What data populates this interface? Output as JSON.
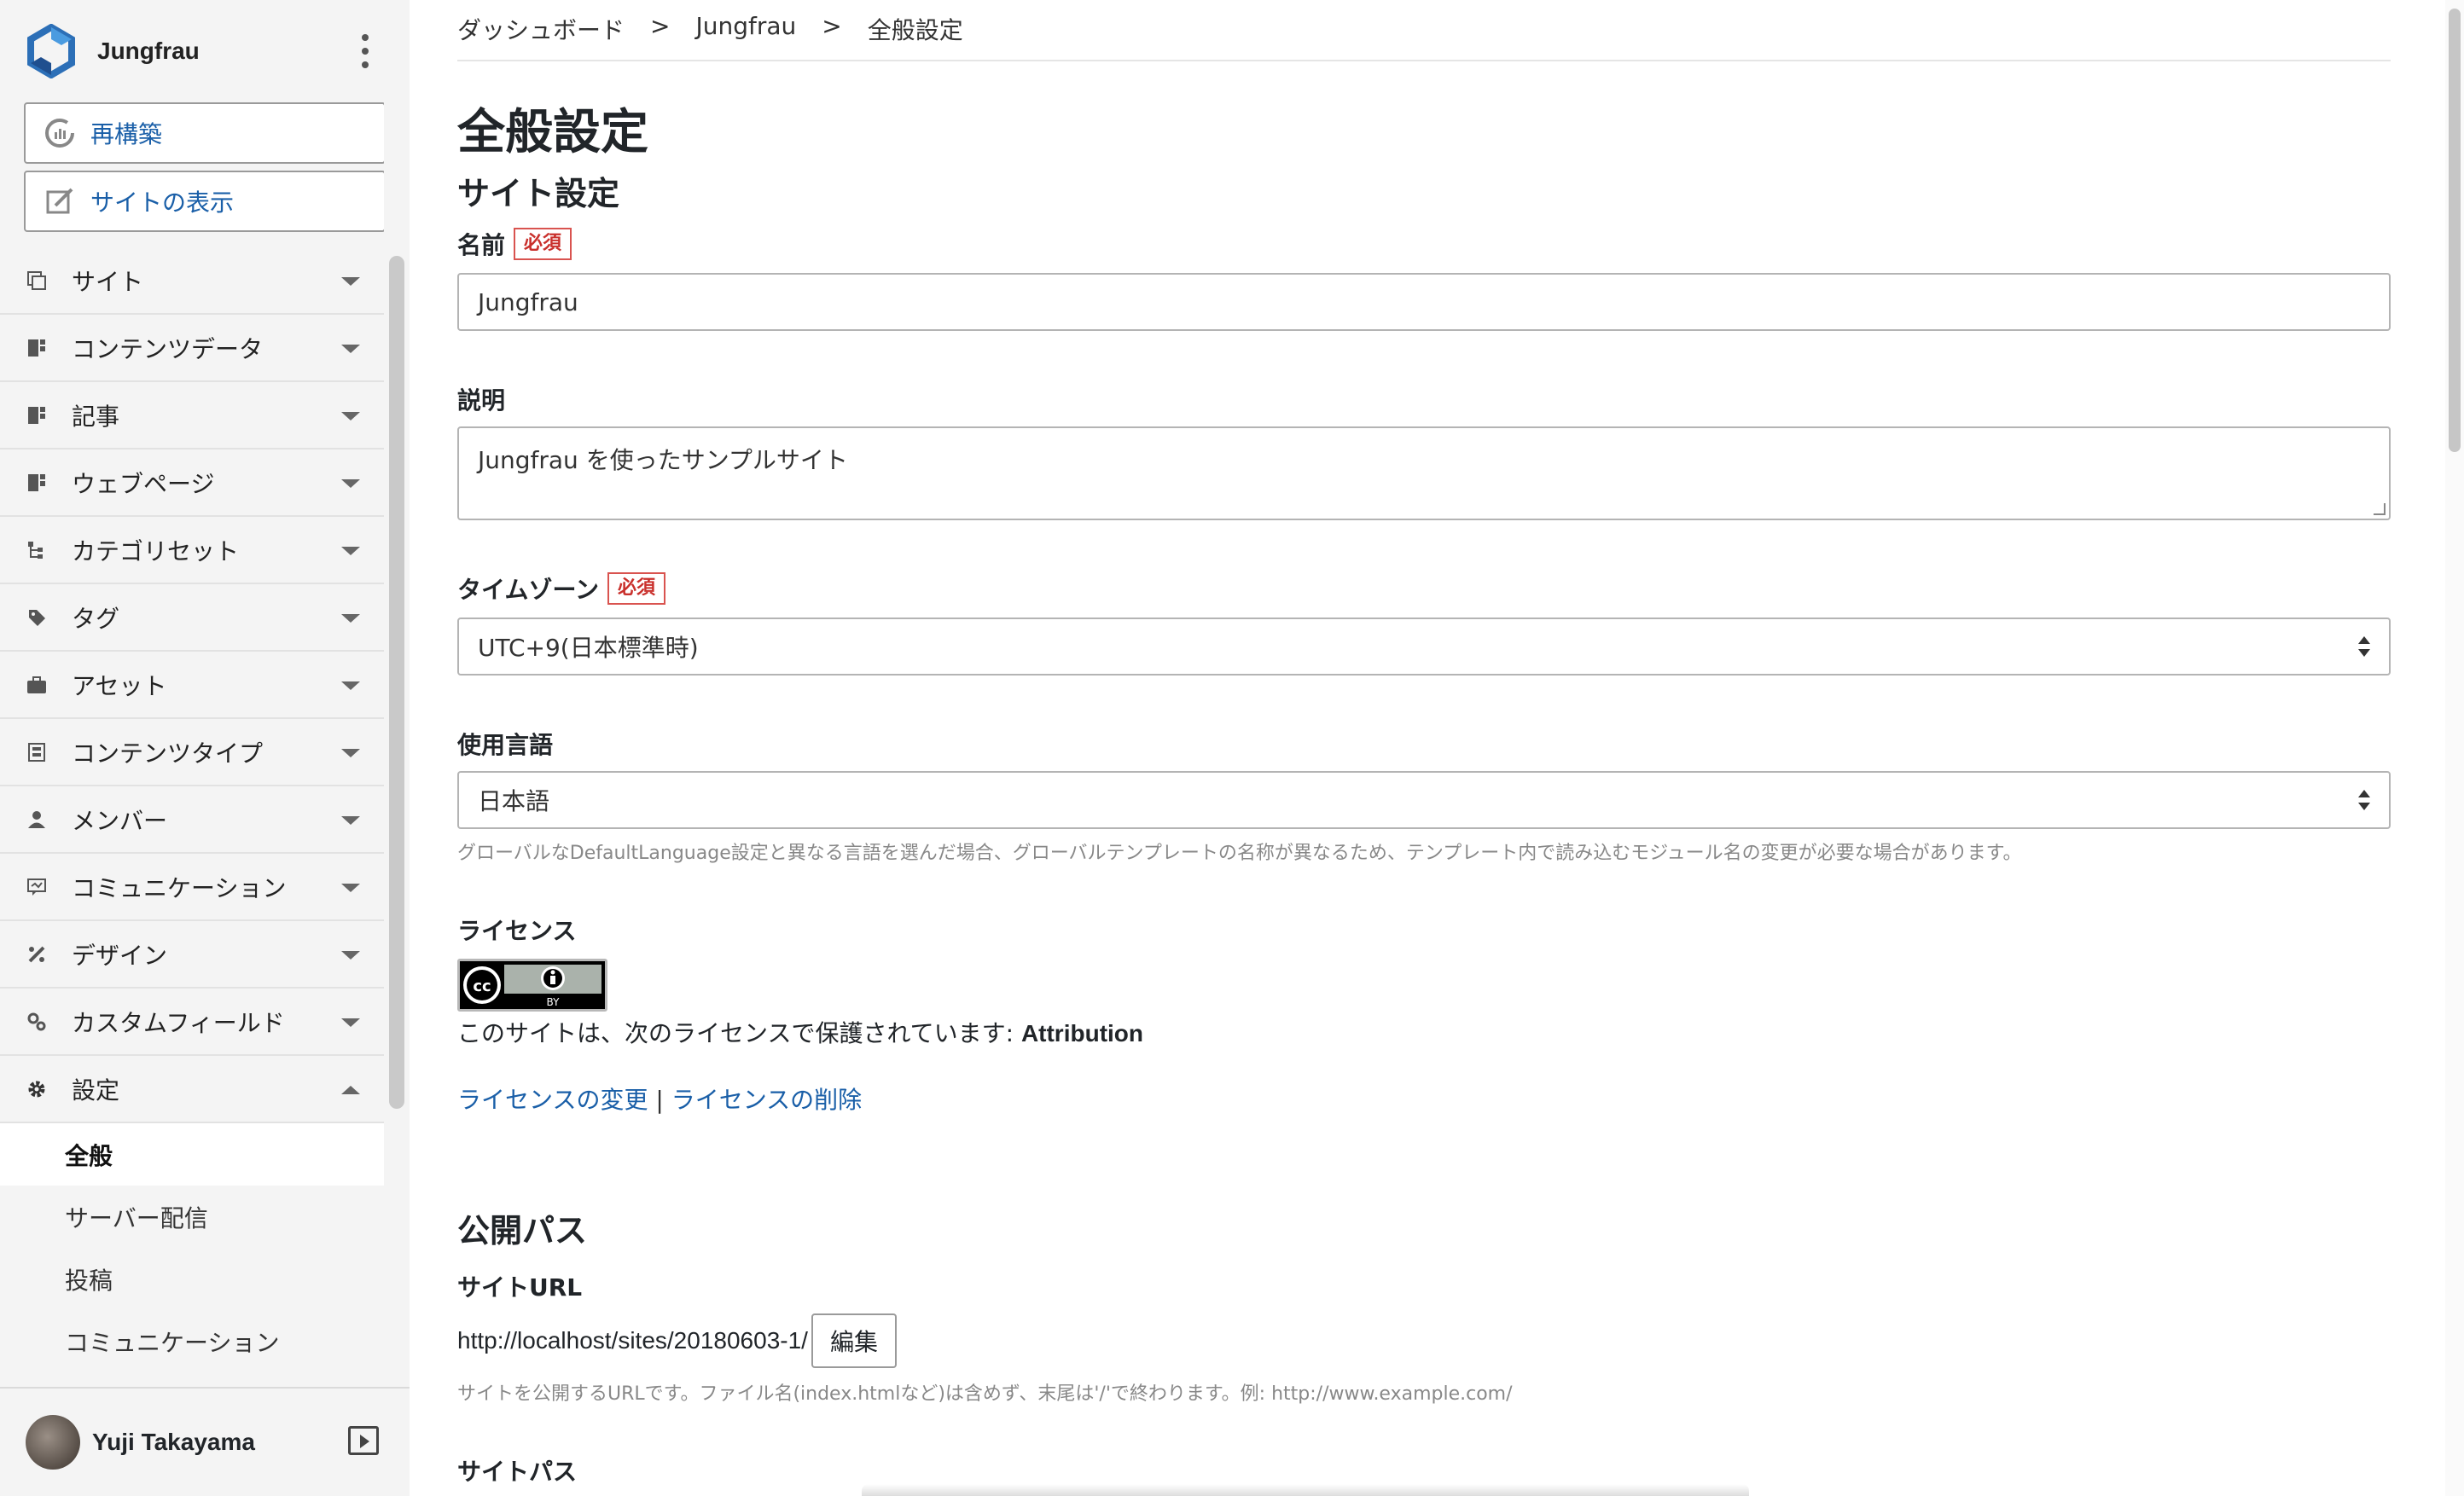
{
  "sidebar": {
    "site_name": "Jungfrau",
    "rebuild_label": "再構築",
    "view_site_label": "サイトの表示",
    "menu": [
      {
        "label": "サイト",
        "icon": "site-icon"
      },
      {
        "label": "コンテンツデータ",
        "icon": "content-data-icon"
      },
      {
        "label": "記事",
        "icon": "entry-icon"
      },
      {
        "label": "ウェブページ",
        "icon": "page-icon"
      },
      {
        "label": "カテゴリセット",
        "icon": "category-set-icon"
      },
      {
        "label": "タグ",
        "icon": "tag-icon"
      },
      {
        "label": "アセット",
        "icon": "asset-icon"
      },
      {
        "label": "コンテンツタイプ",
        "icon": "content-type-icon"
      },
      {
        "label": "メンバー",
        "icon": "member-icon"
      },
      {
        "label": "コミュニケーション",
        "icon": "communication-icon"
      },
      {
        "label": "デザイン",
        "icon": "design-icon"
      },
      {
        "label": "カスタムフィールド",
        "icon": "custom-field-icon"
      },
      {
        "label": "設定",
        "icon": "gear-icon"
      }
    ],
    "submenu": [
      "全般",
      "サーバー配信",
      "投稿",
      "コミュニケーション"
    ],
    "user_name": "Yuji Takayama"
  },
  "breadcrumb": [
    "ダッシュボード",
    ">",
    "Jungfrau",
    ">",
    "全般設定"
  ],
  "page_title": "全般設定",
  "site_settings": {
    "heading": "サイト設定",
    "required_label": "必須",
    "name_label": "名前",
    "name_value": "Jungfrau",
    "description_label": "説明",
    "description_value": "Jungfrau を使ったサンプルサイト",
    "timezone_label": "タイムゾーン",
    "timezone_value": "UTC+9(日本標準時)",
    "language_label": "使用言語",
    "language_value": "日本語",
    "language_hint": "グローバルなDefaultLanguage設定と異なる言語を選んだ場合、グローバルテンプレートの名称が異なるため、テンプレート内で読み込むモジュール名の変更が必要な場合があります。",
    "license_label": "ライセンス",
    "license_text": "このサイトは、次のライセンスで保護されています: ",
    "license_name": "Attribution",
    "license_badge_text": "BY",
    "license_change": "ライセンスの変更",
    "license_sep": " | ",
    "license_delete": "ライセンスの削除"
  },
  "publish_paths": {
    "heading": "公開パス",
    "site_url_label": "サイトURL",
    "site_url_value": "http://localhost/sites/20180603-1/",
    "edit_label": "編集",
    "site_url_hint": "サイトを公開するURLです。ファイル名(index.htmlなど)は含めず、末尾は'/'で終わります。例: http://www.example.com/",
    "site_path_label": "サイトパス"
  },
  "colors": {
    "link": "#1a5fa8",
    "required": "#c9302c",
    "sidebar_bg": "#f4f4f4"
  }
}
